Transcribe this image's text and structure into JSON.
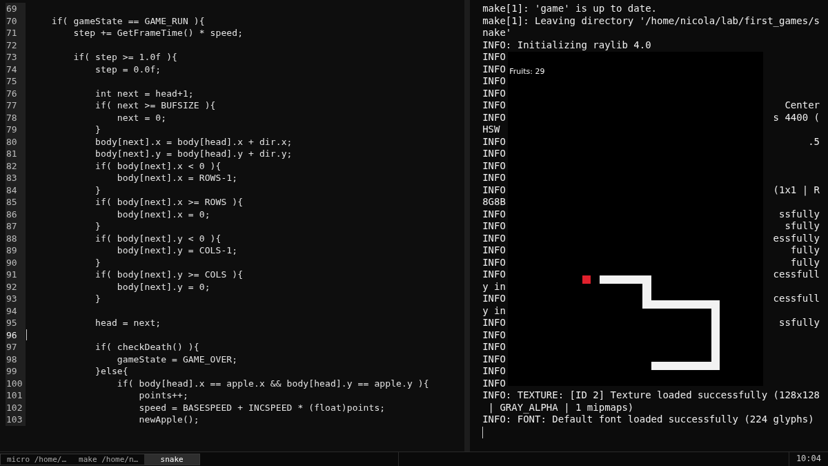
{
  "editor": {
    "lines": [
      {
        "number": "69",
        "cursor": false
      },
      {
        "number": "70",
        "code": "    if( gameState == GAME_RUN ){",
        "cursor": false
      },
      {
        "number": "71",
        "code": "        step += GetFrameTime() * speed;",
        "cursor": false
      },
      {
        "number": "72",
        "cursor": false
      },
      {
        "number": "73",
        "code": "        if( step >= 1.0f ){",
        "cursor": false
      },
      {
        "number": "74",
        "code": "            step = 0.0f;",
        "cursor": false
      },
      {
        "number": "75",
        "cursor": false
      },
      {
        "number": "76",
        "code": "            int next = head+1;",
        "cursor": false
      },
      {
        "number": "77",
        "code": "            if( next >= BUFSIZE ){",
        "cursor": false
      },
      {
        "number": "78",
        "code": "                next = 0;",
        "cursor": false
      },
      {
        "number": "79",
        "code": "            }",
        "cursor": false
      },
      {
        "number": "80",
        "code": "            body[next].x = body[head].x + dir.x;",
        "cursor": false
      },
      {
        "number": "81",
        "code": "            body[next].y = body[head].y + dir.y;",
        "cursor": false
      },
      {
        "number": "82",
        "code": "            if( body[next].x < 0 ){",
        "cursor": false
      },
      {
        "number": "83",
        "code": "                body[next].x = ROWS-1;",
        "cursor": false
      },
      {
        "number": "84",
        "code": "            }",
        "cursor": false
      },
      {
        "number": "85",
        "code": "            if( body[next].x >= ROWS ){",
        "cursor": false
      },
      {
        "number": "86",
        "code": "                body[next].x = 0;",
        "cursor": false
      },
      {
        "number": "87",
        "code": "            }",
        "cursor": false
      },
      {
        "number": "88",
        "code": "            if( body[next].y < 0 ){",
        "cursor": false
      },
      {
        "number": "89",
        "code": "                body[next].y = COLS-1;",
        "cursor": false
      },
      {
        "number": "90",
        "code": "            }",
        "cursor": false
      },
      {
        "number": "91",
        "code": "            if( body[next].y >= COLS ){",
        "cursor": false
      },
      {
        "number": "92",
        "code": "                body[next].y = 0;",
        "cursor": false
      },
      {
        "number": "93",
        "code": "            }",
        "cursor": false
      },
      {
        "number": "94",
        "cursor": false
      },
      {
        "number": "95",
        "code": "            head = next;",
        "cursor": false
      },
      {
        "number": "96",
        "cursor": true
      },
      {
        "number": "97",
        "code": "            if( checkDeath() ){",
        "cursor": false
      },
      {
        "number": "98",
        "code": "                gameState = GAME_OVER;",
        "cursor": false
      },
      {
        "number": "99",
        "code": "            }else{",
        "cursor": false
      },
      {
        "number": "100",
        "code": "                if( body[head].x == apple.x && body[head].y == apple.y ){",
        "cursor": false
      },
      {
        "number": "101",
        "code": "                    points++;",
        "cursor": false
      },
      {
        "number": "102",
        "code": "                    speed = BASESPEED + INCSPEED * (float)points;",
        "cursor": false
      },
      {
        "number": "103",
        "code": "                    newApple();",
        "cursor": false
      }
    ]
  },
  "terminal": {
    "lines": [
      {
        "left": "make[1]: 'game' is up to date."
      },
      {
        "left": "make[1]: Leaving directory '/home/nicola/lab/first_games/s"
      },
      {
        "left": "nake'"
      },
      {
        "left": "INFO: Initializing raylib 4.0"
      },
      {
        "left": "INFO"
      },
      {
        "left": "INFO"
      },
      {
        "left": "INFO"
      },
      {
        "left": "INFO"
      },
      {
        "left": "INFO",
        "right": "Center"
      },
      {
        "left": "INFO",
        "right": "s 4400 ("
      },
      {
        "left": "HSW"
      },
      {
        "left": "INFO",
        "right": ".5"
      },
      {
        "left": "INFO"
      },
      {
        "left": "INFO"
      },
      {
        "left": "INFO"
      },
      {
        "left": "INFO",
        "right": "(1x1 | R"
      },
      {
        "left": "8G8B"
      },
      {
        "left": "INFO",
        "right": "ssfully"
      },
      {
        "left": "INFO",
        "right": "sfully"
      },
      {
        "left": "INFO",
        "right": "essfully"
      },
      {
        "left": "INFO",
        "right": "fully"
      },
      {
        "left": "INFO",
        "right": "fully"
      },
      {
        "left": "INFO",
        "right": "cessfull"
      },
      {
        "left": "y in"
      },
      {
        "left": "INFO",
        "right": "cessfull"
      },
      {
        "left": "y in"
      },
      {
        "left": "INFO",
        "right": "ssfully"
      },
      {
        "left": "INFO"
      },
      {
        "left": "INFO"
      },
      {
        "left": "INFO"
      },
      {
        "left": "INFO"
      },
      {
        "left": "INFO"
      },
      {
        "left": "INFO: TEXTURE: [ID 2] Texture loaded successfully (128x128"
      },
      {
        "left": " | GRAY_ALPHA | 1 mipmaps)"
      },
      {
        "left": "INFO: FONT: Default font loaded successfully (224 glyphs)"
      }
    ]
  },
  "game_window": {
    "score": "Fruits: 29"
  },
  "taskbar": {
    "tabs": [
      {
        "label": "micro /home/…",
        "selected": false
      },
      {
        "label": "make /home/n…",
        "selected": false
      },
      {
        "label": "snake",
        "selected": true
      }
    ],
    "clock": "10:04"
  }
}
